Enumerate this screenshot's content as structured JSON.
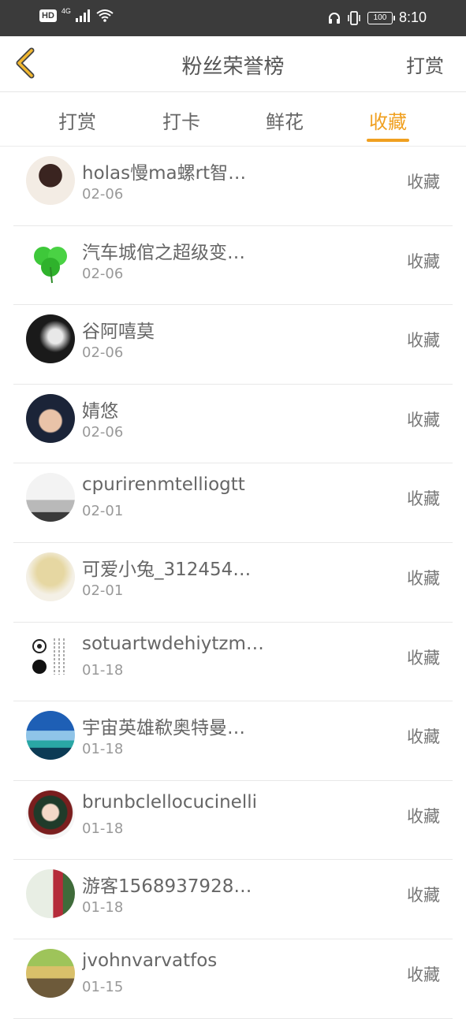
{
  "status_bar": {
    "hd": "HD",
    "network": "4G",
    "battery": "100",
    "time": "8:10"
  },
  "header": {
    "title": "粉丝荣誉榜",
    "right_action": "打赏"
  },
  "tabs": [
    {
      "label": "打赏",
      "active": false
    },
    {
      "label": "打卡",
      "active": false
    },
    {
      "label": "鲜花",
      "active": false
    },
    {
      "label": "收藏",
      "active": true
    }
  ],
  "accent_color": "#f0a020",
  "list": [
    {
      "name": "holas慢ma螺rt智…",
      "date": "02-06",
      "action": "收藏"
    },
    {
      "name": "汽车城倌之超级变…",
      "date": "02-06",
      "action": "收藏"
    },
    {
      "name": "谷阿嘻莫",
      "date": "02-06",
      "action": "收藏"
    },
    {
      "name": "婧悠",
      "date": "02-06",
      "action": "收藏"
    },
    {
      "name": "cpurirenmtelliogtt",
      "date": "02-01",
      "action": "收藏"
    },
    {
      "name": "可爱小兔_312454…",
      "date": "02-01",
      "action": "收藏"
    },
    {
      "name": "sotuartwdehiytzm…",
      "date": "01-18",
      "action": "收藏"
    },
    {
      "name": "宇宙英雄欷奥特曼…",
      "date": "01-18",
      "action": "收藏"
    },
    {
      "name": "brunbclellocucinelli",
      "date": "01-18",
      "action": "收藏"
    },
    {
      "name": "游客1568937928…",
      "date": "01-18",
      "action": "收藏"
    },
    {
      "name": "jvohnvarvatfos",
      "date": "01-15",
      "action": "收藏"
    }
  ]
}
